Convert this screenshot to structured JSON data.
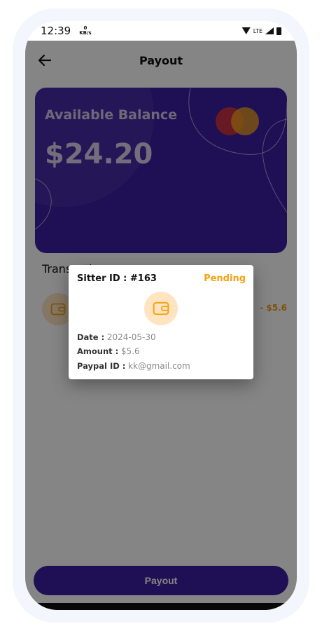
{
  "status_bar": {
    "time": "12:39",
    "net_speed": "0",
    "net_unit": "KB/s",
    "network_label": "LTE"
  },
  "header": {
    "title": "Payout"
  },
  "balance_card": {
    "label": "Available Balance",
    "amount": "$24.20"
  },
  "transactions": {
    "section_title": "Transactions",
    "items": [
      {
        "amount": "- $5.6"
      }
    ]
  },
  "dialog": {
    "title": "Sitter ID : #163",
    "status": "Pending",
    "date_label": "Date :",
    "date_value": "2024-05-30",
    "amount_label": "Amount :",
    "amount_value": "$5.6",
    "paypal_label": "Paypal ID :",
    "paypal_value": "kk@gmail.com"
  },
  "footer": {
    "button_label": "Payout"
  },
  "colors": {
    "primary": "#3d1fa3",
    "pending": "#f5a20f",
    "icon_bg": "#ffe4c2",
    "amount": "#f09a1a"
  },
  "icons": {
    "back": "arrow-left-icon",
    "card_brand": "mastercard-icon",
    "wallet": "wallet-icon"
  }
}
